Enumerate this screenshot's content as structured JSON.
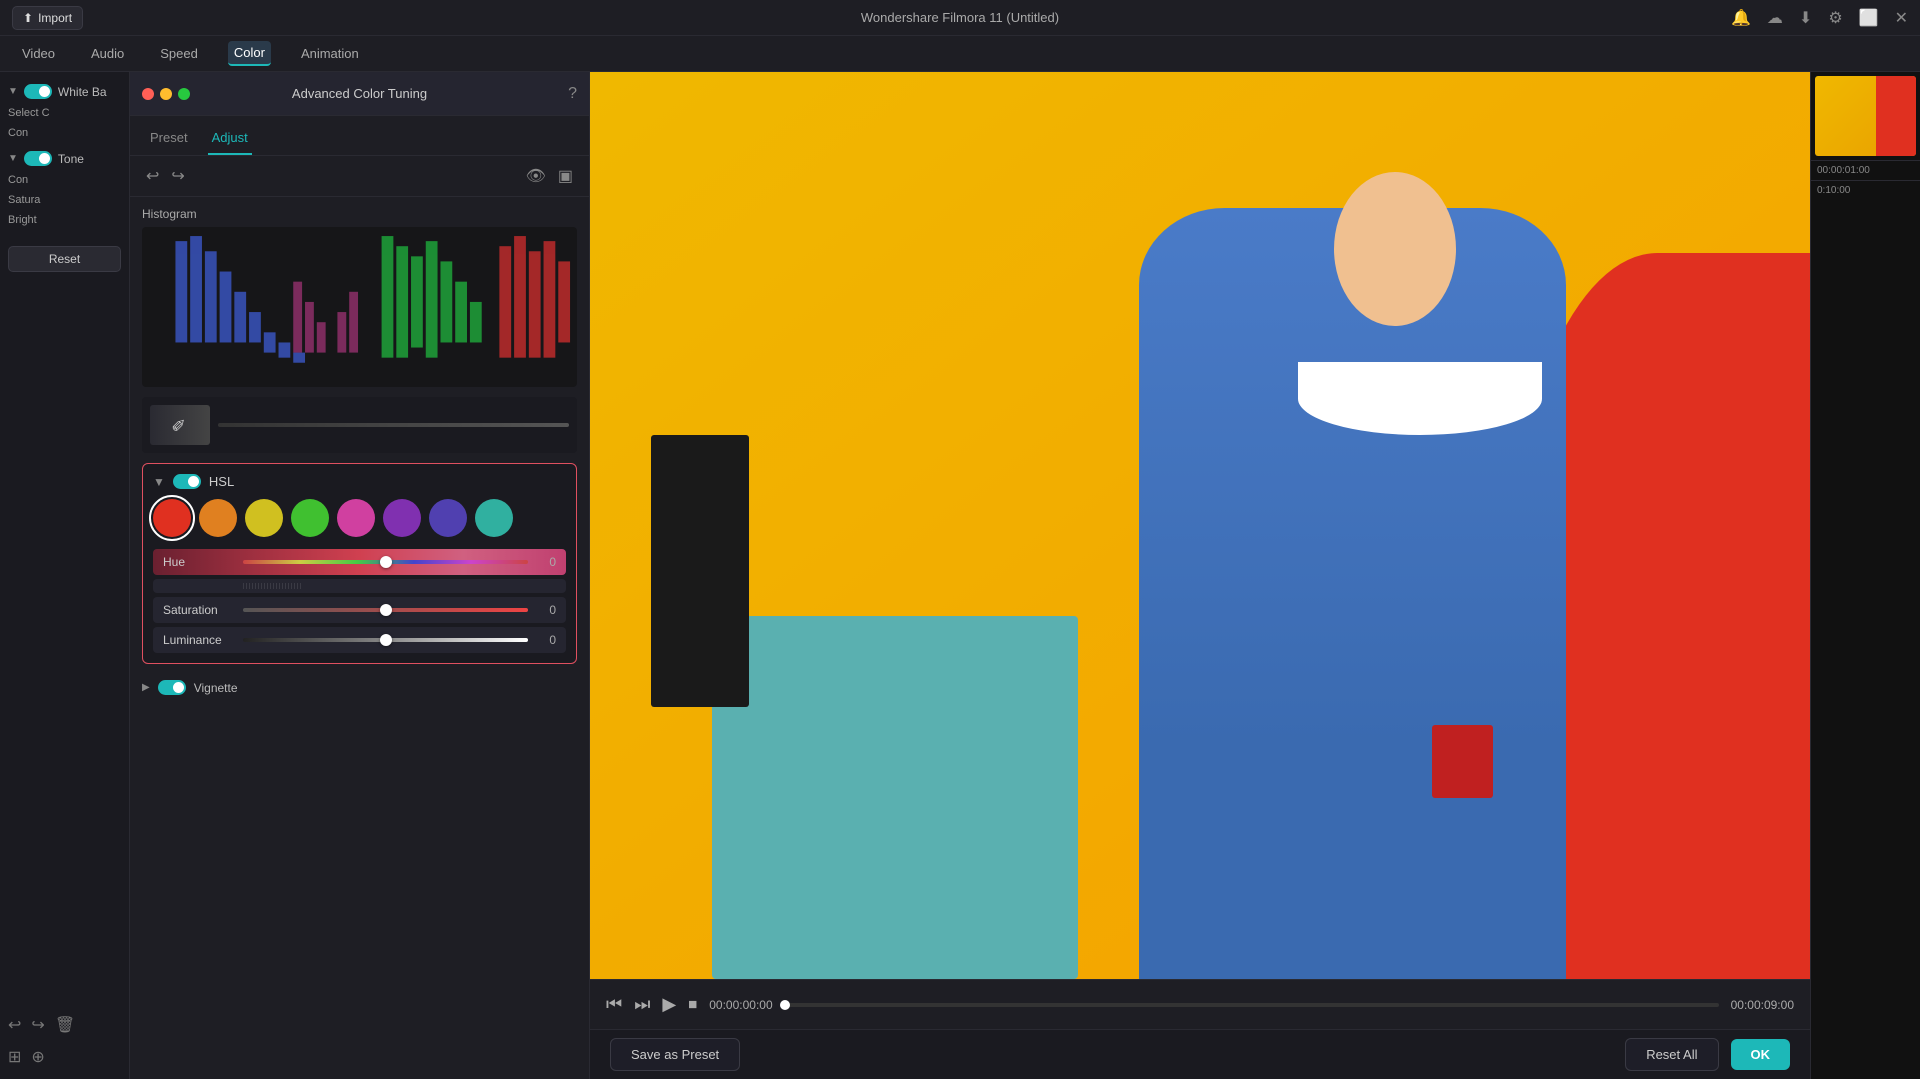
{
  "app": {
    "title": "Wondershare Filmora 11 (Untitled)",
    "import_label": "Import"
  },
  "menu": {
    "items": [
      {
        "label": "Video",
        "active": false
      },
      {
        "label": "Audio",
        "active": false
      },
      {
        "label": "Speed",
        "active": false
      },
      {
        "label": "Color",
        "active": true
      },
      {
        "label": "Animation",
        "active": false
      }
    ]
  },
  "left_panel": {
    "white_balance_label": "White Ba",
    "tone_label": "Tone",
    "contrast_label": "Con",
    "saturation_label": "Satura",
    "brightness_label": "Bright",
    "reset_label": "Reset"
  },
  "color_panel": {
    "title": "Advanced Color Tuning",
    "tabs": [
      {
        "label": "Preset",
        "active": false
      },
      {
        "label": "Adjust",
        "active": true
      }
    ],
    "histogram_label": "Histogram",
    "hsl": {
      "label": "HSL",
      "enabled": true,
      "colors": [
        {
          "name": "red",
          "hex": "#e03020"
        },
        {
          "name": "orange",
          "hex": "#e08020"
        },
        {
          "name": "yellow",
          "hex": "#d0c020"
        },
        {
          "name": "green",
          "hex": "#40c030"
        },
        {
          "name": "pink-magenta",
          "hex": "#d040a0"
        },
        {
          "name": "purple",
          "hex": "#8030b0"
        },
        {
          "name": "blue-purple",
          "hex": "#5040b0"
        },
        {
          "name": "teal",
          "hex": "#30b0a0"
        }
      ],
      "sliders": [
        {
          "label": "Hue",
          "value": 0,
          "percent": 50
        },
        {
          "label": "Saturation",
          "value": 0,
          "percent": 50
        },
        {
          "label": "Luminance",
          "value": 0,
          "percent": 50
        }
      ]
    },
    "vignette_label": "Vignette"
  },
  "video": {
    "current_time": "00:00:00:00",
    "total_time": "00:00:09:00"
  },
  "bottom": {
    "save_preset_label": "Save as Preset",
    "reset_all_label": "Reset All",
    "ok_label": "OK"
  }
}
